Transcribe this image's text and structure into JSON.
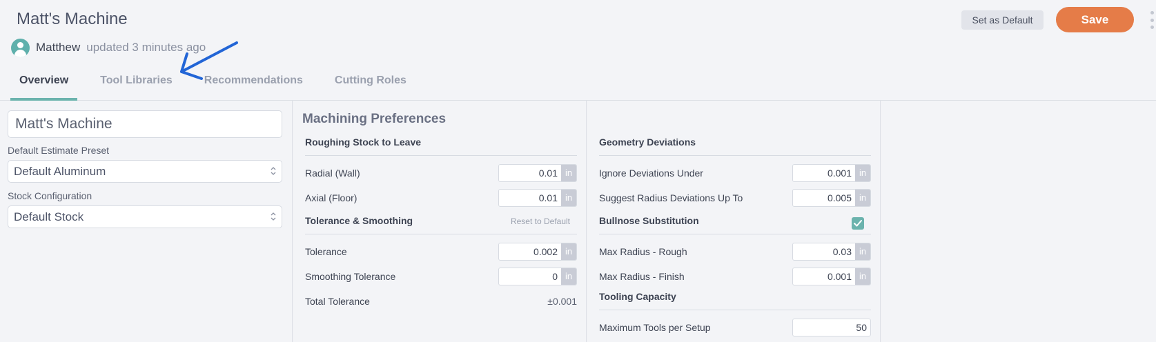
{
  "header": {
    "title": "Matt's Machine",
    "updated_by": "Matthew",
    "updated_text": "updated 3 minutes ago",
    "set_default_label": "Set as Default",
    "save_label": "Save"
  },
  "tabs": [
    {
      "label": "Overview",
      "active": true
    },
    {
      "label": "Tool Libraries",
      "active": false
    },
    {
      "label": "Recommendations",
      "active": false
    },
    {
      "label": "Cutting Roles",
      "active": false
    }
  ],
  "left": {
    "machine_name": "Matt's Machine",
    "preset_label": "Default Estimate Preset",
    "preset_value": "Default Aluminum",
    "stock_label": "Stock Configuration",
    "stock_value": "Default Stock"
  },
  "machining": {
    "title": "Machining Preferences",
    "roughing": {
      "title": "Roughing Stock to Leave",
      "radial_label": "Radial (Wall)",
      "radial_value": "0.01",
      "axial_label": "Axial (Floor)",
      "axial_value": "0.01"
    },
    "tolerance": {
      "title": "Tolerance & Smoothing",
      "reset_label": "Reset to Default",
      "tolerance_label": "Tolerance",
      "tolerance_value": "0.002",
      "smoothing_label": "Smoothing Tolerance",
      "smoothing_value": "0",
      "total_label": "Total Tolerance",
      "total_value": "±0.001"
    },
    "unit": "in"
  },
  "geometry": {
    "title": "Geometry Deviations",
    "ignore_label": "Ignore Deviations Under",
    "ignore_value": "0.001",
    "suggest_label": "Suggest Radius Deviations Up To",
    "suggest_value": "0.005",
    "bullnose_title": "Bullnose Substitution",
    "bullnose_checked": true,
    "max_rough_label": "Max Radius - Rough",
    "max_rough_value": "0.03",
    "max_finish_label": "Max Radius - Finish",
    "max_finish_value": "0.001",
    "tooling_title": "Tooling Capacity",
    "max_tools_label": "Maximum Tools per Setup",
    "max_tools_value": "50"
  },
  "colors": {
    "accent": "#6bb3ad",
    "save_button": "#e57c48",
    "annotation_arrow": "#2265d6"
  }
}
